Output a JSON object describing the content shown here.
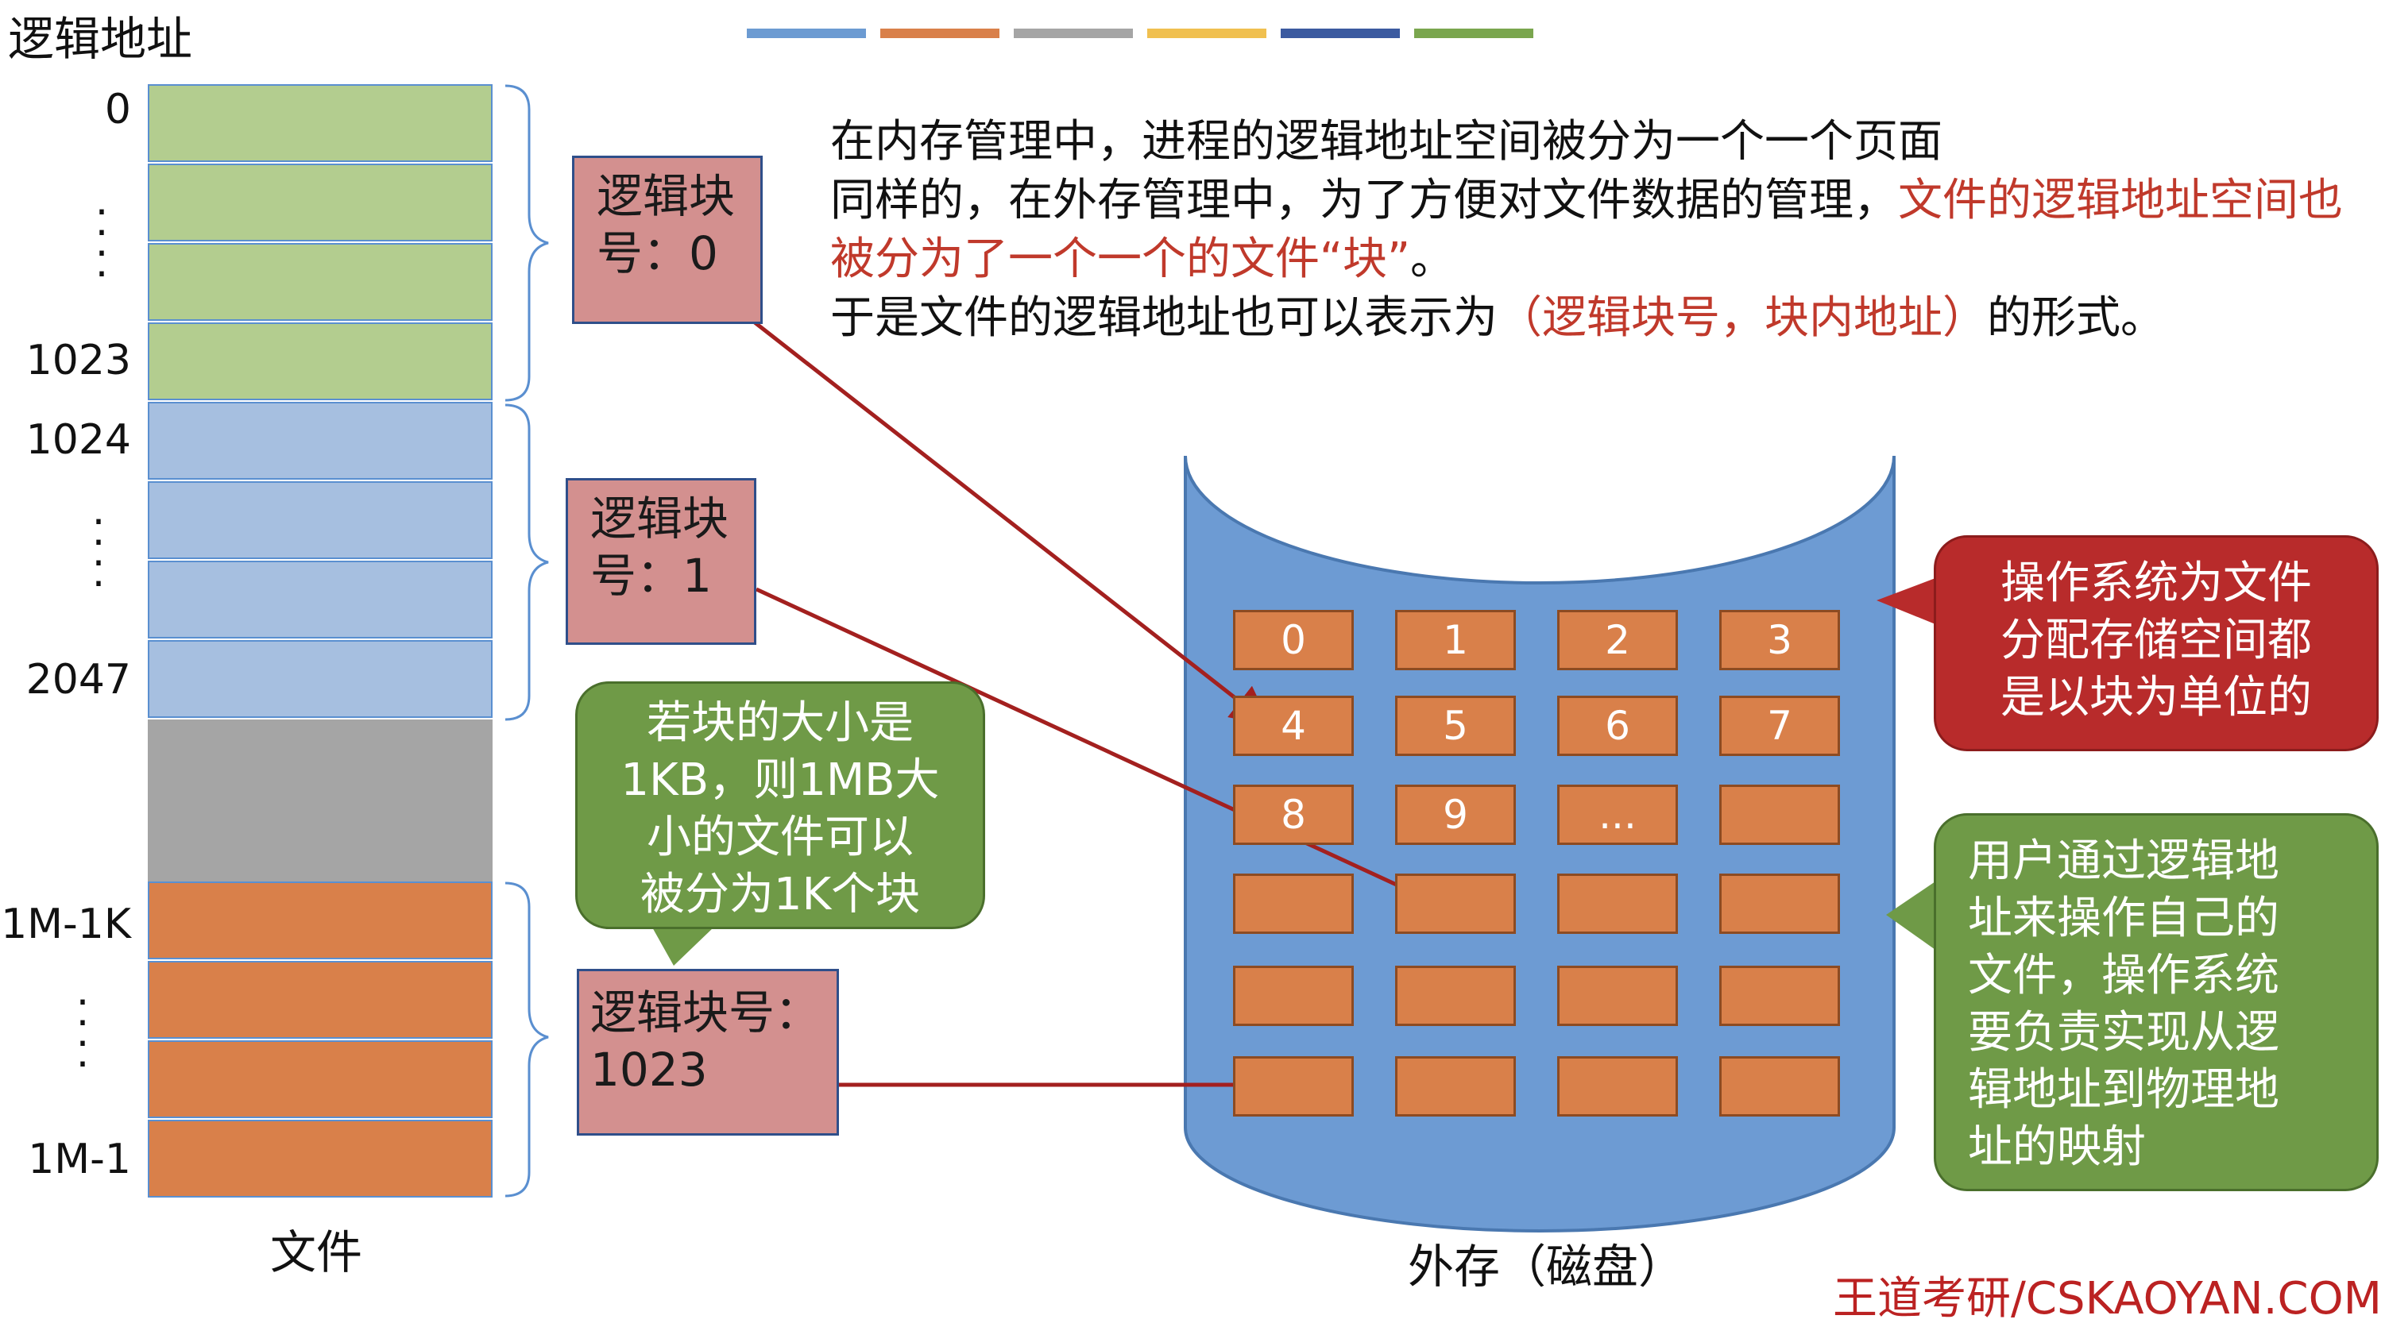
{
  "header": {
    "title": "逻辑地址",
    "legend_colors": [
      "#6c9bd2",
      "#d9804a",
      "#a5a5a5",
      "#f0c050",
      "#3b5aa0",
      "#7aa64e"
    ]
  },
  "file_column": {
    "caption": "文件",
    "addresses": {
      "a0": "0",
      "a1023": "1023",
      "a1024": "1024",
      "a2047": "2047",
      "a1m1k": "1M-1K",
      "a1m1": "1M-1"
    },
    "colors": {
      "green": "#b3cd8f",
      "blue": "#a6bfe0",
      "gray": "#a5a5a5",
      "orange": "#d9804a"
    }
  },
  "logical_blocks": {
    "b0": "逻辑块\n号：0",
    "b1": "逻辑块\n号：1",
    "b1023": "逻辑块号：\n1023"
  },
  "intro": {
    "line1": "在内存管理中，进程的逻辑地址空间被分为一个一个页面",
    "line2a": "同样的，在外存管理中，为了方便对文件数据的管理，",
    "line2b": "文件的逻辑地址空间也被分为了一个一个的文件“块”",
    "line2c": "。",
    "line3a": "于是文件的逻辑地址也可以表示为",
    "line3b": "（逻辑块号，块内地址）",
    "line3c": "的形式。"
  },
  "callouts": {
    "block_size": "若块的大小是\n1KB，则1MB大\n小的文件可以\n被分为1K个块",
    "alloc": "操作系统为文件\n分配存储空间都\n是以块为单位的",
    "user": "用户通过逻辑地\n址来操作自己的\n文件，操作系统\n要负责实现从逻\n辑地址到物理地\n址的映射"
  },
  "disk": {
    "caption": "外存（磁盘）",
    "block_labels": [
      "0",
      "1",
      "2",
      "3",
      "4",
      "5",
      "6",
      "7",
      "8",
      "9",
      "...",
      "",
      "",
      "",
      "",
      "",
      "",
      "",
      "",
      "",
      "",
      "",
      "",
      ""
    ]
  },
  "watermark": "王道考研/CSKAOYAN.COM"
}
